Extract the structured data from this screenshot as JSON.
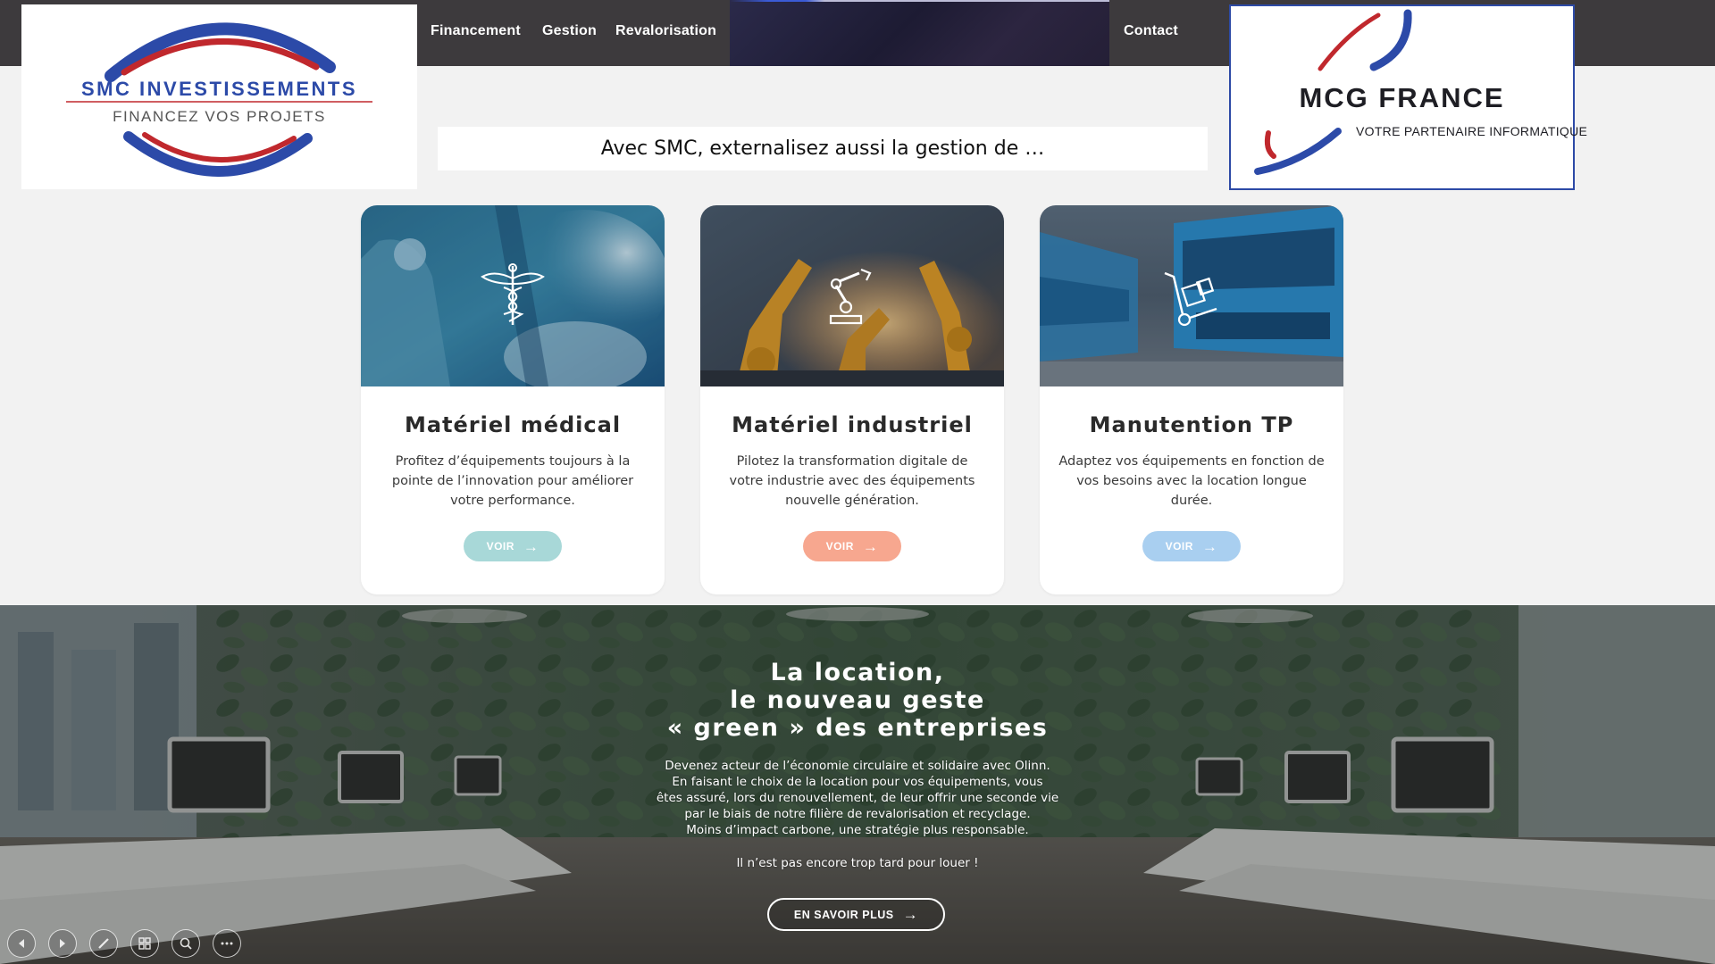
{
  "nav": {
    "items": [
      "Financement",
      "Gestion",
      "Revalorisation"
    ],
    "contact": "Contact"
  },
  "logos": {
    "left": {
      "name": "SMC INVESTISSEMENTS",
      "tagline": "FINANCEZ VOS PROJETS"
    },
    "right": {
      "name": "MCG FRANCE",
      "tagline": "VOTRE PARTENAIRE INFORMATIQUE"
    }
  },
  "banner": "Avec SMC, externalisez aussi la gestion de …",
  "cards": [
    {
      "title": "Matériel médical",
      "description": "Profitez d’équipements toujours à la pointe de l’innovation pour améliorer votre performance.",
      "button": "VOIR",
      "icon": "caduceus-icon",
      "button_color": "#a8d8d8"
    },
    {
      "title": "Matériel industriel",
      "description": "Pilotez la transformation digitale de votre industrie avec des équipements nouvelle génération.",
      "button": "VOIR",
      "icon": "robot-arm-icon",
      "button_color": "#f7a78f"
    },
    {
      "title": "Manutention TP",
      "description": "Adaptez vos équipements en fonction de vos besoins avec la location longue durée.",
      "button": "VOIR",
      "icon": "hand-truck-icon",
      "button_color": "#a9cff0"
    }
  ],
  "hero": {
    "title": [
      "La location,",
      "le nouveau geste",
      "« green » des entreprises"
    ],
    "body": [
      "Devenez acteur de l’économie circulaire et solidaire avec Olinn.",
      "En faisant le choix de la location pour vos équipements, vous",
      "êtes assuré, lors du renouvellement, de leur offrir une seconde vie",
      "par le biais de notre filière de revalorisation et recyclage.",
      "Moins d’impact carbone, une stratégie plus responsable."
    ],
    "closing": "Il n’est pas encore trop tard pour louer !",
    "button": "EN SAVOIR PLUS"
  },
  "slideshow_controls": [
    "previous-icon",
    "next-icon",
    "pen-icon",
    "slides-grid-icon",
    "zoom-icon",
    "more-icon"
  ],
  "colors": {
    "nav_bg": "#3d3a3d",
    "brand_blue": "#2c4aa8",
    "brand_red": "#c0282d"
  }
}
